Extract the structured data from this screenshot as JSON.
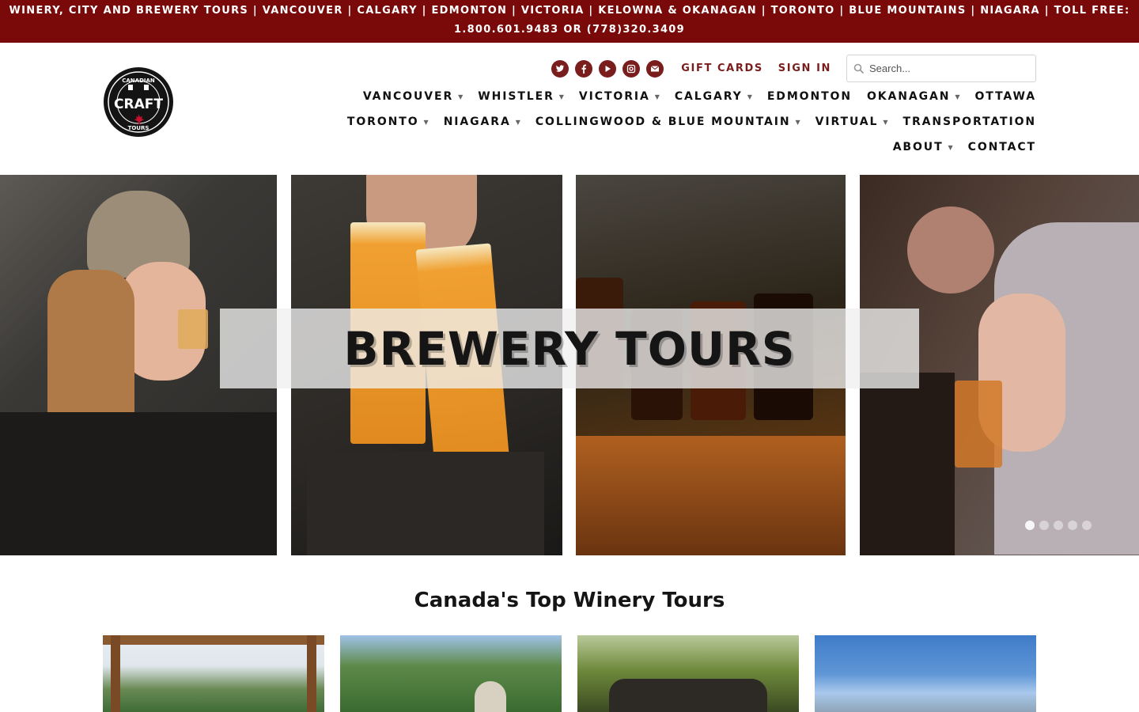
{
  "announcement": {
    "line1": "WINERY, CITY AND BREWERY TOURS | VANCOUVER | CALGARY | EDMONTON | VICTORIA | KELOWNA & OKANAGAN | TORONTO | BLUE MOUNTAINS | NIAGARA | TOLL FREE:",
    "line2": "1.800.601.9483 OR (778)320.3409"
  },
  "logo": {
    "top_text": "CANADIAN",
    "main_text": "CRAFT",
    "bottom_text": "TOURS"
  },
  "social": [
    "twitter-icon",
    "facebook-icon",
    "youtube-icon",
    "instagram-icon",
    "email-icon"
  ],
  "utility": {
    "gift_cards": "GIFT CARDS",
    "sign_in": "SIGN IN",
    "search_placeholder": "Search..."
  },
  "nav": {
    "row1": [
      {
        "label": "VANCOUVER",
        "caret": "▼"
      },
      {
        "label": "WHISTLER",
        "caret": "▼"
      },
      {
        "label": "VICTORIA",
        "caret": "▼"
      },
      {
        "label": "CALGARY",
        "caret": "▼"
      },
      {
        "label": "EDMONTON",
        "caret": ""
      },
      {
        "label": "OKANAGAN",
        "caret": "▼"
      },
      {
        "label": "OTTAWA",
        "caret": ""
      }
    ],
    "row2": [
      {
        "label": "TORONTO",
        "caret": "▼"
      },
      {
        "label": "NIAGARA",
        "caret": "▼"
      },
      {
        "label": "COLLINGWOOD & BLUE MOUNTAIN",
        "caret": "▼"
      },
      {
        "label": "VIRTUAL",
        "caret": "▼"
      },
      {
        "label": "TRANSPORTATION",
        "caret": ""
      }
    ],
    "row3": [
      {
        "label": "ABOUT",
        "caret": "▼"
      },
      {
        "label": "CONTACT",
        "caret": ""
      }
    ]
  },
  "hero": {
    "title": "BREWERY TOURS",
    "slides_total": 5,
    "active_slide": 1
  },
  "section": {
    "title": "Canada's Top Winery Tours"
  },
  "colors": {
    "brand": "#7a0a0a",
    "accent_link": "#7a1d1d",
    "text": "#111111"
  }
}
